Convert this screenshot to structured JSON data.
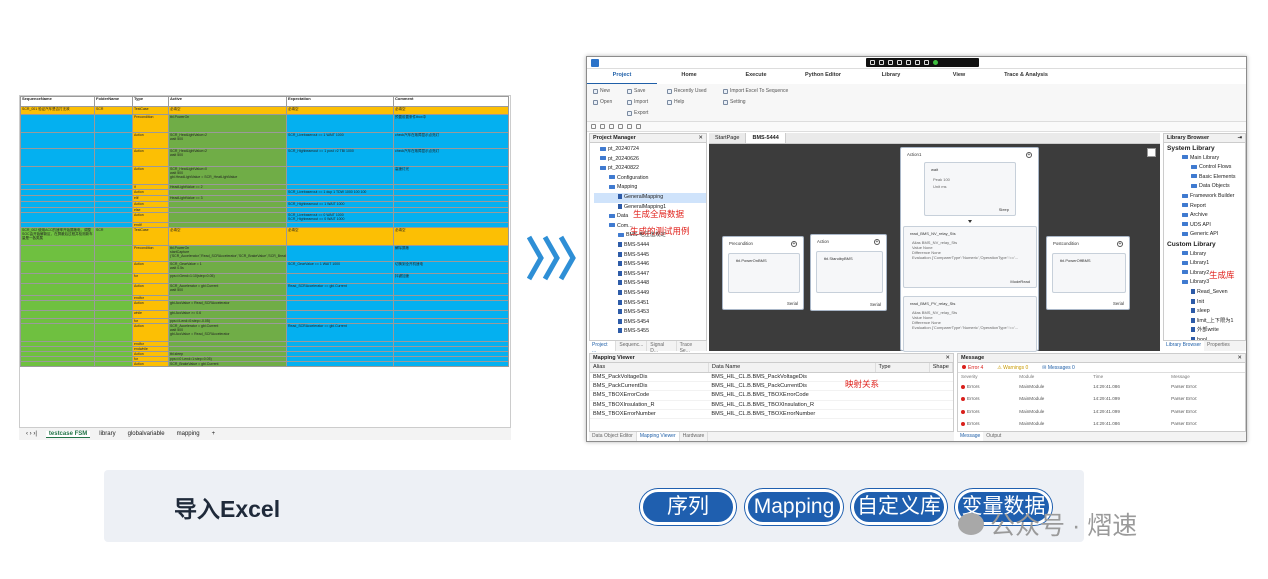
{
  "sheet": {
    "headers": [
      "SequenceName",
      "FolderName",
      "Type",
      "Active",
      "Expectation",
      "Comment"
    ],
    "rows": [
      {
        "c": [
          "cy",
          "cy",
          "cy",
          "cy",
          "cy",
          "cy"
        ],
        "t": [
          "SCR_001 验证汽车是否打无故",
          "SCR",
          "TestCase",
          "必填空",
          "必填空",
          "必填空"
        ],
        "h": 8
      },
      {
        "c": [
          "cb",
          "cb",
          "cy",
          "cg",
          "cb",
          "cb"
        ],
        "t": [
          "",
          "",
          "Precondition",
          "tbl.PowerOn",
          "",
          "预置前置条件tbox中"
        ],
        "h": 18
      },
      {
        "c": [
          "cb",
          "cb",
          "cy",
          "cg",
          "cb",
          "cb"
        ],
        "t": [
          "",
          "",
          "Action",
          "SCR_HeatLightValue=2\nwait 500",
          "SCR_Livebaserout == 1 WAIT 1000",
          "check汽车在故障显示点亮灯"
        ],
        "h": 16
      },
      {
        "c": [
          "cb",
          "cb",
          "cy",
          "cg",
          "cb",
          "cb"
        ],
        "t": [
          "",
          "",
          "Action",
          "SCR_HeatLightValue=2\nwait 500",
          "SCR_Highbeamout == 1 post >2 TBI 1000",
          "check汽车在故障显示点亮灯"
        ],
        "h": 18
      },
      {
        "c": [
          "cb",
          "cb",
          "cy",
          "cg",
          "cb",
          "cb"
        ],
        "t": [
          "",
          "",
          "Action",
          "SCR_HeatLightValue=0\nwait 500\ngbi.HeadLightValue = SCR_HeatLightValue",
          "",
          "高速灯光"
        ],
        "h": 18
      },
      {
        "c": [
          "cb",
          "cb",
          "cy",
          "cg",
          "cb",
          "cb"
        ],
        "t": [
          "",
          "",
          "if",
          "HeadLightValue == 2",
          "",
          ""
        ],
        "h": 5
      },
      {
        "c": [
          "cb",
          "cb",
          "cy",
          "cg",
          "cb",
          "cb"
        ],
        "t": [
          "",
          "",
          "Action",
          "",
          "SCR_Livebaserout == 1 dup 1 TDW 1000 100 100",
          ""
        ],
        "h": 6
      },
      {
        "c": [
          "cb",
          "cb",
          "cy",
          "cg",
          "cb",
          "cb"
        ],
        "t": [
          "",
          "",
          "elif",
          "HeadLightValue == 3",
          "",
          ""
        ],
        "h": 6
      },
      {
        "c": [
          "cb",
          "cb",
          "cy",
          "cg",
          "cb",
          "cb"
        ],
        "t": [
          "",
          "",
          "Action",
          "",
          "SCR_Highbeamout == 1 WAIT 1000",
          ""
        ],
        "h": 6
      },
      {
        "c": [
          "cb",
          "cb",
          "cy",
          "cg",
          "cb",
          "cb"
        ],
        "t": [
          "",
          "",
          "else",
          "",
          "",
          ""
        ],
        "h": 5
      },
      {
        "c": [
          "cb",
          "cb",
          "cy",
          "cg",
          "cb",
          "cb"
        ],
        "t": [
          "",
          "",
          "Action",
          "",
          "SCR_Livebaserout == 0 WAIT 1000\nSCR_Highbeamout == 0 WAIT 1000",
          ""
        ],
        "h": 10
      },
      {
        "c": [
          "cb",
          "cb",
          "cy",
          "cg",
          "cb",
          "cb"
        ],
        "t": [
          "",
          "",
          "endif",
          "",
          "",
          ""
        ],
        "h": 5
      },
      {
        "c": [
          "cgr",
          "cgr",
          "cy",
          "cy",
          "cy",
          "cy"
        ],
        "t": [
          "SCR_002 使用ACC的速率开始屏蔽电，调整SOC由开始解新区，在屏蔽后过程并检测新车量是一各类属",
          "SCR",
          "TestCase",
          "必填空",
          "必填空",
          "必填空"
        ],
        "h": 18
      },
      {
        "c": [
          "cgr",
          "cgr",
          "cy",
          "cg",
          "cb",
          "cb"
        ],
        "t": [
          "",
          "",
          "Precondition",
          "tbl.PowerOn\nstartCapture ('SCR_Accelerator','Read_SCRAccelerator','SCR_BrakeValue','SCR_BreakLight')",
          "",
          "解除屏蔽"
        ],
        "h": 16
      },
      {
        "c": [
          "cgr",
          "cgr",
          "cy",
          "cg",
          "cb",
          "cb"
        ],
        "t": [
          "",
          "",
          "Action",
          "SCR_GearValue = 1\nwait 0.5s",
          "SCR_GearValue == 1 WAIT 1000",
          "切换到全开机速电"
        ],
        "h": 12
      },
      {
        "c": [
          "cgr",
          "cgr",
          "cy",
          "cg",
          "cb",
          "cb"
        ],
        "t": [
          "",
          "",
          "for",
          "pps=i:Gend=1:10(step=0.05)",
          "",
          "抖键加速"
        ],
        "h": 10
      },
      {
        "c": [
          "cgr",
          "cgr",
          "cy",
          "cg",
          "cb",
          "cb"
        ],
        "t": [
          "",
          "",
          "Action",
          "SCR_Accelerator = gbi.Current\nwait 500",
          "Read_SCRAccelerator == gbi.Current",
          ""
        ],
        "h": 12
      },
      {
        "c": [
          "cgr",
          "cgr",
          "cy",
          "cg",
          "cb",
          "cb"
        ],
        "t": [
          "",
          "",
          "endfor",
          "",
          "",
          ""
        ],
        "h": 5
      },
      {
        "c": [
          "cgr",
          "cgr",
          "cy",
          "cg",
          "cb",
          "cb"
        ],
        "t": [
          "",
          "",
          "Action",
          "gbi.AccValue = Read_SCRAccelerator",
          "",
          ""
        ],
        "h": 10
      },
      {
        "c": [
          "cgr",
          "cgr",
          "cy",
          "cg",
          "cb",
          "cb"
        ],
        "t": [
          "",
          "",
          "while",
          "gbi.AccValue >= 0.6",
          "",
          ""
        ],
        "h": 8
      },
      {
        "c": [
          "cgr",
          "cgr",
          "cy",
          "cg",
          "cb",
          "cb"
        ],
        "t": [
          "",
          "",
          "for",
          "pps=i:Lend=0:step=-0.05)",
          "",
          ""
        ],
        "h": 5
      },
      {
        "c": [
          "cgr",
          "cgr",
          "cy",
          "cg",
          "cb",
          "cb"
        ],
        "t": [
          "",
          "",
          "Action",
          "SCR_Accelerator = gbi.Current\nwait 500\ngbi.AccValue = Read_SCRAccelerator",
          "Read_SCRAccelerator == gbi.Current",
          ""
        ],
        "h": 18
      },
      {
        "c": [
          "cgr",
          "cgr",
          "cy",
          "cg",
          "cb",
          "cb"
        ],
        "t": [
          "",
          "",
          "endfor",
          "",
          "",
          ""
        ],
        "h": 5
      },
      {
        "c": [
          "cgr",
          "cgr",
          "cy",
          "cg",
          "cb",
          "cb"
        ],
        "t": [
          "",
          "",
          "endwhile",
          "",
          "",
          ""
        ],
        "h": 5
      },
      {
        "c": [
          "cgr",
          "cgr",
          "cy",
          "cg",
          "cb",
          "cb"
        ],
        "t": [
          "",
          "",
          "Action",
          "tbl.sleep",
          "",
          ""
        ],
        "h": 5
      },
      {
        "c": [
          "cgr",
          "cgr",
          "cy",
          "cg",
          "cb",
          "cb"
        ],
        "t": [
          "",
          "",
          "for",
          "pps=i:0 Lend=1:step=0.05)",
          "",
          ""
        ],
        "h": 5
      },
      {
        "c": [
          "cgr",
          "cgr",
          "cy",
          "cg",
          "cb",
          "cb"
        ],
        "t": [
          "",
          "",
          "Action",
          "SCR_BrakeValue = gbi.Current",
          "",
          ""
        ],
        "h": 5
      }
    ],
    "tabs": [
      "testcase FSM",
      "library",
      "globalvariable",
      "mapping",
      "+"
    ],
    "nav": "‹ › ›|"
  },
  "app": {
    "menus": [
      "Project",
      "Home",
      "Execute",
      "Python Editor",
      "Library",
      "View",
      "Trace & Analysis"
    ],
    "ribbon": {
      "new": "New",
      "open": "Open",
      "save": "Save",
      "import": "Import",
      "export": "Export",
      "recent": "Recently Used",
      "help": "Help",
      "import_excel": "Import Excel To Sequence",
      "setting": "Setting"
    },
    "project_manager": {
      "title": "Project Manager",
      "items": [
        {
          "t": "pt_20240724",
          "d": 0,
          "k": "fold"
        },
        {
          "t": "pt_20240626",
          "d": 0,
          "k": "fold"
        },
        {
          "t": "pt_20240822",
          "d": 0,
          "k": "fold"
        },
        {
          "t": "Configuration",
          "d": 1,
          "k": "fold"
        },
        {
          "t": "Mapping",
          "d": 1,
          "k": "fold"
        },
        {
          "t": "GeneralMapping",
          "d": 2,
          "k": "file",
          "sel": true
        },
        {
          "t": "GeneralMapping1",
          "d": 2,
          "k": "file"
        },
        {
          "t": "Data",
          "d": 1,
          "k": "fold"
        },
        {
          "t": "Com...",
          "d": 1,
          "k": "fold"
        },
        {
          "t": "BMS-电压值规定",
          "d": 2,
          "k": "fold"
        },
        {
          "t": "BMS-5444",
          "d": 2,
          "k": "file"
        },
        {
          "t": "BMS-5445",
          "d": 2,
          "k": "file"
        },
        {
          "t": "BMS-5446",
          "d": 2,
          "k": "file"
        },
        {
          "t": "BMS-5447",
          "d": 2,
          "k": "file"
        },
        {
          "t": "BMS-5448",
          "d": 2,
          "k": "file"
        },
        {
          "t": "BMS-5449",
          "d": 2,
          "k": "file"
        },
        {
          "t": "BMS-5451",
          "d": 2,
          "k": "file"
        },
        {
          "t": "BMS-5453",
          "d": 2,
          "k": "file"
        },
        {
          "t": "BMS-5454",
          "d": 2,
          "k": "file"
        },
        {
          "t": "BMS-5455",
          "d": 2,
          "k": "file"
        }
      ],
      "tabs": [
        "Project ...",
        "Sequenc...",
        "Signal D...",
        "Trace Se..."
      ],
      "note_global": "生成全局数据",
      "note_cases": "生成的测试用例"
    },
    "doc_tabs": [
      "StartPage",
      "BMS-5444"
    ],
    "canvas": {
      "action1": "Action1",
      "wait": "wait",
      "wait_p1": "Peak 100",
      "wait_p2": "Unit ms",
      "sleep": "Sleep",
      "precondition": "Precondition",
      "pre_inner": "tbl.PowerOnBMS",
      "serial": "Serial",
      "action": "Action",
      "act_inner": "tbl.StandbyBMS",
      "read1": "read_BMS_NV_relay_Sts",
      "read2": "read_BMS_PV_relay_Sts",
      "read_lines": [
        "Alias BMS_NV_relay_Sts",
        "Value None",
        "Difference None",
        "Evaluation {'ComparerType':'Numeric','OperationType':'=='..."
      ],
      "mode_read": "ModeRead",
      "postcondition": "Postcondition",
      "post_inner": "tbl.PowerOffBMS"
    },
    "library": {
      "title": "Library Browser",
      "items": [
        {
          "t": "System Library",
          "d": 0,
          "b": true
        },
        {
          "t": "Main Library",
          "d": 1,
          "k": "fold"
        },
        {
          "t": "Control Flows",
          "d": 2,
          "k": "fold"
        },
        {
          "t": "Basic Elements",
          "d": 2,
          "k": "fold"
        },
        {
          "t": "Data Objects",
          "d": 2,
          "k": "fold"
        },
        {
          "t": "Framework Builder",
          "d": 1,
          "k": "fold"
        },
        {
          "t": "Report",
          "d": 1,
          "k": "fold"
        },
        {
          "t": "Archive",
          "d": 1,
          "k": "fold"
        },
        {
          "t": "UDS API",
          "d": 1,
          "k": "fold"
        },
        {
          "t": "Generic API",
          "d": 1,
          "k": "fold"
        },
        {
          "t": "Custom Library",
          "d": 0,
          "b": true
        },
        {
          "t": "Library",
          "d": 1,
          "k": "fold"
        },
        {
          "t": "Library1",
          "d": 1,
          "k": "fold"
        },
        {
          "t": "Library2",
          "d": 1,
          "k": "fold"
        },
        {
          "t": "Library3",
          "d": 1,
          "k": "fold"
        },
        {
          "t": "Read_Seven",
          "d": 2,
          "k": "file"
        },
        {
          "t": "Init",
          "d": 2,
          "k": "file"
        },
        {
          "t": "sleep",
          "d": 2,
          "k": "file"
        },
        {
          "t": "limit_上下限为1",
          "d": 2,
          "k": "file"
        },
        {
          "t": "外部write",
          "d": 2,
          "k": "file"
        },
        {
          "t": "bool",
          "d": 2,
          "k": "file"
        },
        {
          "t": "Library4",
          "d": 1,
          "k": "fold"
        }
      ],
      "tabs": [
        "Library Browser",
        "Properties"
      ],
      "note": "生成库"
    },
    "mapping_viewer": {
      "title": "Mapping Viewer",
      "cols": [
        "Alias",
        "Data Name",
        "Type",
        "Shape"
      ],
      "rows": [
        [
          "BMS_PackVoltageDis",
          "BMS_HIL_CL.B.BMS_PackVoltageDis"
        ],
        [
          "BMS_PackCurrentDis",
          "BMS_HIL_CL.B.BMS_PackCurrentDis"
        ],
        [
          "BMS_TBOXErrorCode",
          "BMS_HIL_CL.B.BMS_TBOXErrorCode"
        ],
        [
          "BMS_TBOXInsulation_R",
          "BMS_HIL_CL.B.BMS_TBOXInsulation_R"
        ],
        [
          "BMS_TBOXErrorNumber",
          "BMS_HIL_CL.B.BMS_TBOXErrorNumber"
        ]
      ],
      "tabs": [
        "Data Object Editor",
        "Mapping Viewer",
        "Hardware"
      ],
      "note": "映射关系"
    },
    "message": {
      "title": "Message",
      "errors": "Error 4",
      "warnings": "Warnings 0",
      "messages": "Messages 0",
      "cols": [
        "Severity",
        "Module",
        "Time",
        "Message"
      ],
      "rows": [
        [
          "Errors",
          "MainModule",
          "14:29:41.086",
          "Parser Error:"
        ],
        [
          "Errors",
          "MainModule",
          "14:29:41.099",
          "Parser Error:"
        ],
        [
          "Errors",
          "MainModule",
          "14:29:41.099",
          "Parser Error:"
        ],
        [
          "Errors",
          "MainModule",
          "14:29:41.086",
          "Parser Error:"
        ]
      ],
      "tabs": [
        "Message",
        "Output"
      ]
    }
  },
  "banner": {
    "import": "导入Excel",
    "pills": [
      "序列",
      "Mapping",
      "自定义库",
      "变量数据"
    ],
    "watermark": "公众号 · 熠速"
  },
  "colors": {
    "accent": "#1f5faf",
    "arrow": "#2e8fd6",
    "note_red": "#e0211b"
  }
}
